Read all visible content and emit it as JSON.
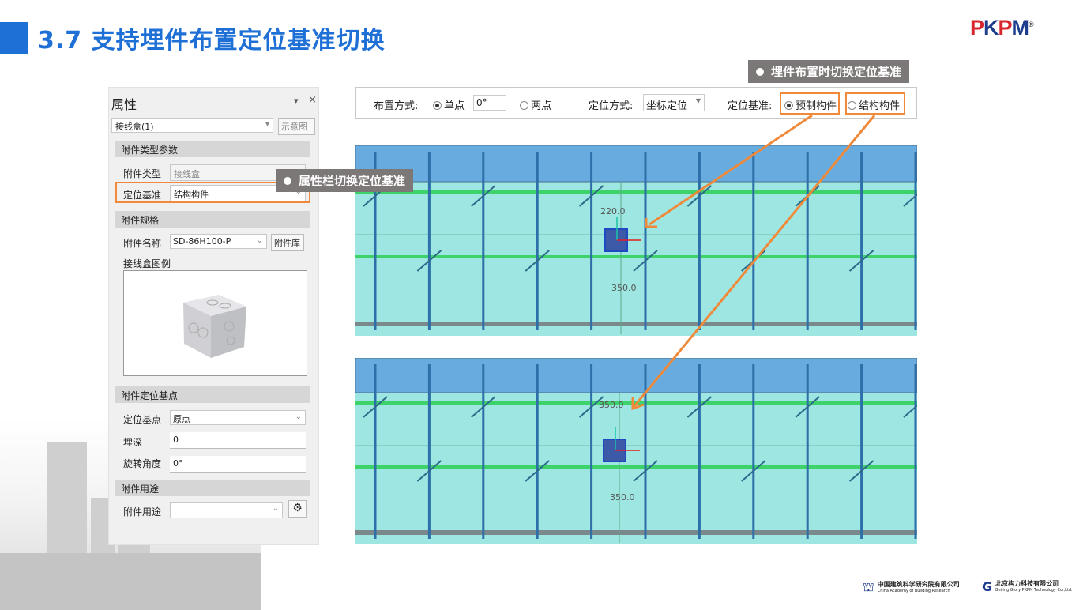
{
  "slide": {
    "title": "3.7 支持埋件布置定位基准切换",
    "brand_logo": "PKPM",
    "brand_color": "#1e6fd6",
    "accent_color": "#f08a3a"
  },
  "callouts": {
    "toolbar": "埋件布置时切换定位基准",
    "panel": "属性栏切换定位基准"
  },
  "panel": {
    "title": "属性",
    "pin": "▾",
    "close": "×",
    "selector": "接线盒(1)",
    "diagram_button": "示意图",
    "sec_type": "附件类型参数",
    "type_label": "附件类型",
    "type_value": "接线盒",
    "basis_label": "定位基准",
    "basis_value": "结构构件",
    "sec_spec": "附件规格",
    "name_label": "附件名称",
    "name_value": "SD-86H100-P",
    "library_button": "附件库",
    "legend_label": "接线盒图例",
    "sec_point": "附件定位基点",
    "point_label": "定位基点",
    "point_value": "原点",
    "depth_label": "埋深",
    "depth_value": "0",
    "rot_label": "旋转角度",
    "rot_value": "0°",
    "sec_use": "附件用途",
    "use_label": "附件用途",
    "use_value": ""
  },
  "toolbar": {
    "layout_label": "布置方式:",
    "single": "单点",
    "angle": "0°",
    "double": "两点",
    "locate_label": "定位方式:",
    "locate_value": "坐标定位",
    "basis_label": "定位基准:",
    "basis_precast": "预制构件",
    "basis_struct": "结构构件",
    "selected": "预制构件"
  },
  "views": {
    "top": {
      "dim_upper": "220.0",
      "dim_lower": "350.0"
    },
    "bottom": {
      "dim_upper": "350.0",
      "dim_lower": "350.0"
    }
  },
  "footer": {
    "org1_cn": "中国建筑科学研究院有限公司",
    "org1_en": "China Academy of Building Research",
    "org2_cn": "北京构力科技有限公司",
    "org2_en": "Beijing Glory PKPM Technology Co.,Ltd."
  }
}
